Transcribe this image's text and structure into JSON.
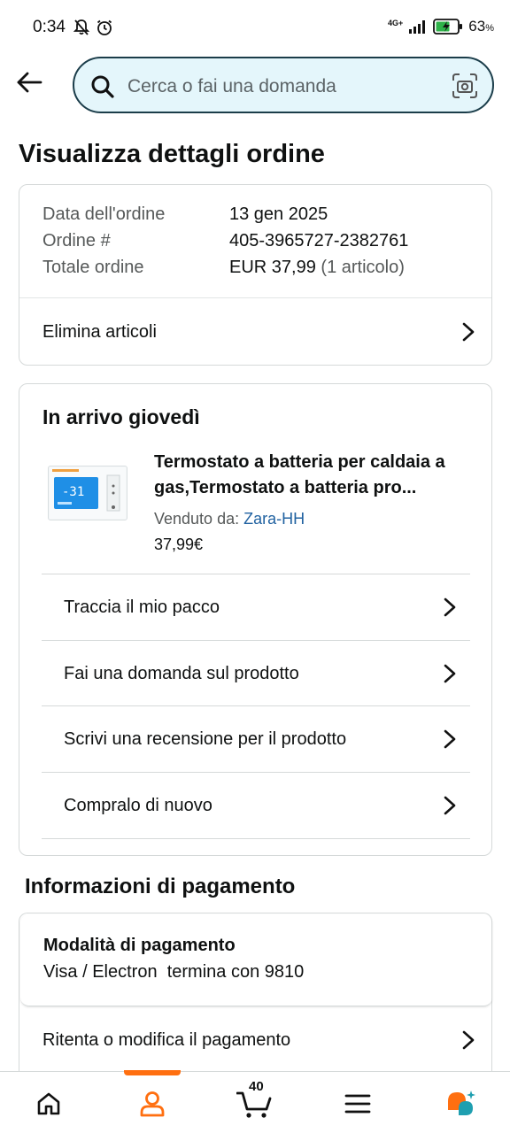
{
  "status_bar": {
    "time": "0:34",
    "network": "4G+",
    "battery": "63",
    "battery_unit": "%"
  },
  "search": {
    "placeholder": "Cerca o fai una domanda"
  },
  "page_title": "Visualizza dettagli ordine",
  "order_summary": {
    "rows": [
      {
        "label": "Data dell'ordine",
        "value": "13 gen 2025"
      },
      {
        "label": "Ordine #",
        "value": "405-3965727-2382761"
      },
      {
        "label": "Totale ordine",
        "value": "EUR 37,99",
        "extra": "(1 articolo)"
      }
    ],
    "delete_items_label": "Elimina articoli"
  },
  "shipment": {
    "title": "In arrivo giovedì",
    "product": {
      "name": "Termostato a batteria per caldaia a gas,Termostato a batteria pro...",
      "sold_by_label": "Venduto da:",
      "seller": "Zara-HH",
      "price": "37,99€"
    },
    "actions": [
      "Traccia il mio pacco",
      "Fai una domanda sul prodotto",
      "Scrivi una recensione per il prodotto",
      "Compralo di nuovo"
    ]
  },
  "payment": {
    "section_title": "Informazioni di pagamento",
    "method_title": "Modalità di pagamento",
    "method_value": "Visa / Electron  termina con 9810",
    "retry_label": "Ritenta o modifica il pagamento"
  },
  "bottom_nav": {
    "cart_count": "40",
    "active_tab": "account",
    "accent_color": "#ff6f10"
  }
}
